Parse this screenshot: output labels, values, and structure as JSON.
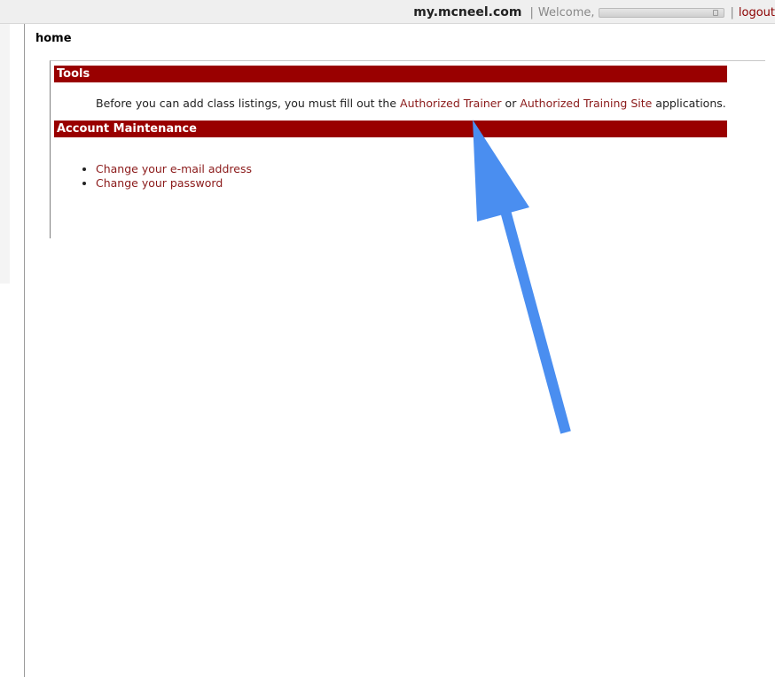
{
  "header": {
    "site_name": "my.mcneel.com",
    "separator": "|",
    "welcome_text": "Welcome,",
    "logout_label": "logout"
  },
  "page": {
    "title": "home"
  },
  "tools": {
    "heading": "Tools",
    "notice_before": "Before you can add class listings, you must fill out the ",
    "trainer_link": "Authorized Trainer",
    "notice_middle": " or ",
    "site_link": "Authorized Training Site",
    "notice_after": " applications."
  },
  "account": {
    "heading": "Account Maintenance",
    "items": [
      {
        "label": "Change your e-mail address"
      },
      {
        "label": "Change your password"
      }
    ]
  },
  "colors": {
    "section_header_bg": "#990000",
    "link": "#8b1a1a",
    "annotation_arrow": "#4a8ef0"
  },
  "annotation": {
    "icon": "arrow-icon"
  }
}
